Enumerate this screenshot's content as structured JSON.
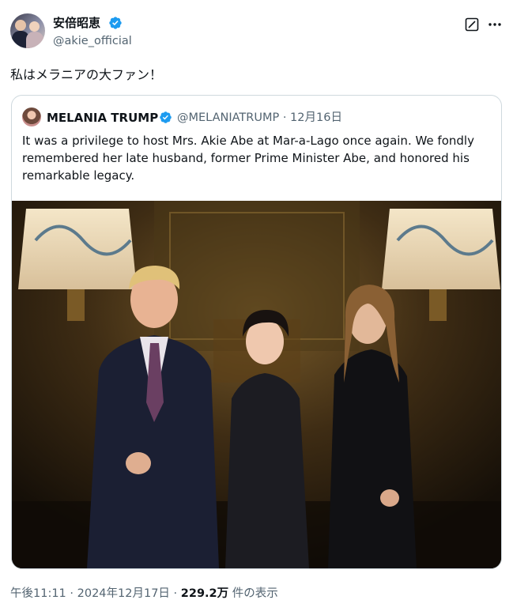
{
  "post": {
    "display_name": "安倍昭恵",
    "handle": "@akie_official",
    "text": "私はメラニアの大ファン！",
    "footer": {
      "time": "午後11:11",
      "separator1": " · ",
      "date": "2024年12月17日",
      "separator2": " · ",
      "views": "229.2万",
      "views_label": " 件の表示"
    }
  },
  "quote": {
    "display_name": "MELANIA TRUMP",
    "handle": "@MELANIATRUMP",
    "separator": " · ",
    "date": "12月16日",
    "text": "It was a privilege to host Mrs. Akie Abe at Mar-a-Lago once again. We fondly remembered her late husband, former Prime Minister Abe, and honored his remarkable legacy."
  },
  "colors": {
    "verified": "#1d9bf0",
    "text_primary": "#0f1419",
    "text_secondary": "#536471",
    "border": "#cfd9de"
  },
  "icons": [
    "verified-badge-icon",
    "grok-icon",
    "more-options-icon"
  ]
}
